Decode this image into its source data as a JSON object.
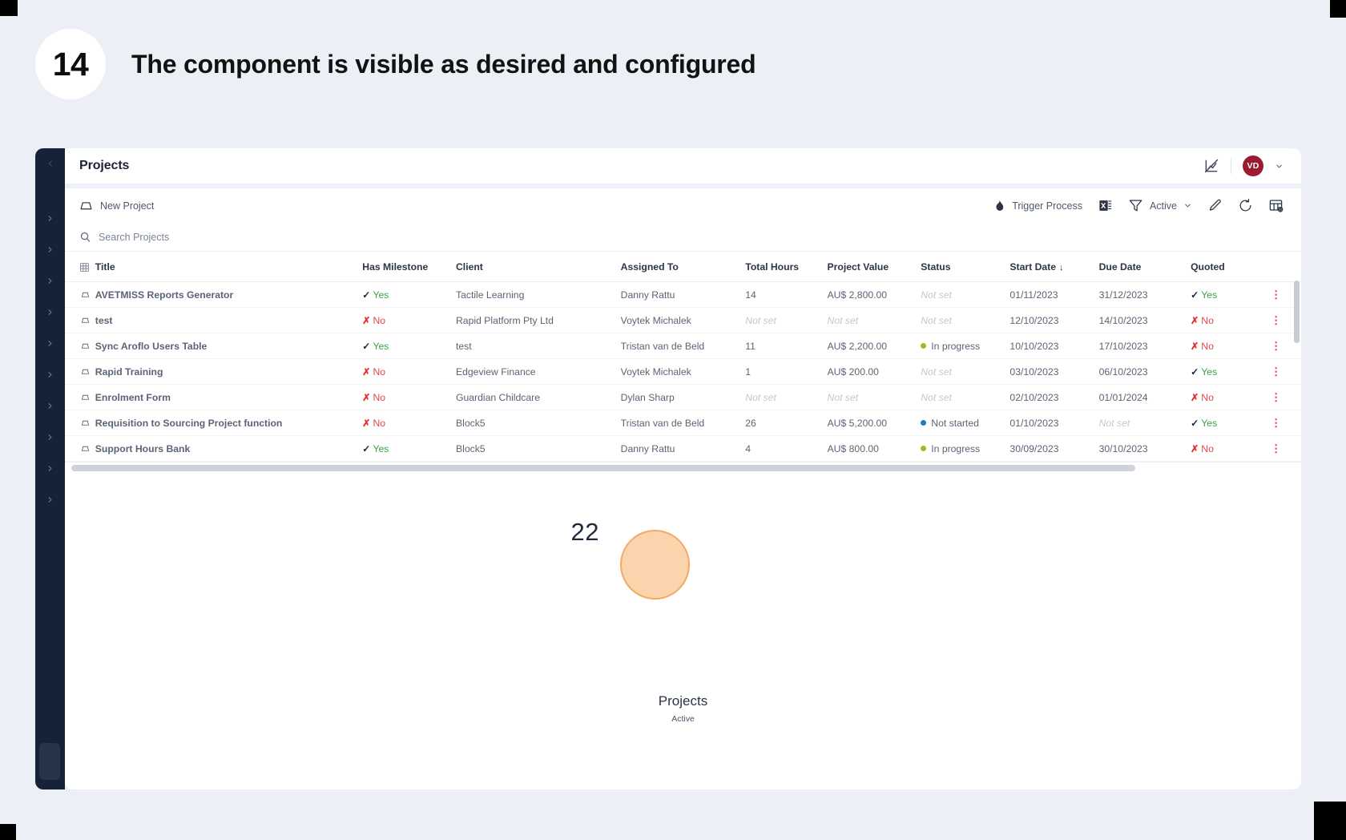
{
  "slide": {
    "step_number": "14",
    "title": "The component is visible as desired and configured"
  },
  "colors": {
    "page_background": "#eceff5",
    "sidebar": "#152238",
    "avatar": "#9b1b30",
    "bubble_fill": "#fbd3ac",
    "bubble_stroke": "#f5a961",
    "status_in_progress": "#8fc31f",
    "status_not_started": "#1f7fb5",
    "yes_green": "#3aa346",
    "no_red": "#e0474c"
  },
  "sidebar": {
    "collapse_icon": "chevron-left-icon",
    "items": [
      {
        "icon": "chevron-right-icon"
      },
      {
        "icon": "chevron-right-icon"
      },
      {
        "icon": "chevron-right-icon"
      },
      {
        "icon": "chevron-right-icon"
      },
      {
        "icon": "chevron-right-icon"
      },
      {
        "icon": "chevron-right-icon"
      },
      {
        "icon": "chevron-right-icon"
      },
      {
        "icon": "chevron-right-icon"
      },
      {
        "icon": "chevron-right-icon"
      },
      {
        "icon": "chevron-right-icon"
      }
    ]
  },
  "header": {
    "title": "Projects",
    "chart_toggle_icon": "chart-off-icon",
    "avatar_initials": "VD",
    "avatar_chevron_icon": "chevron-down-icon"
  },
  "toolbar": {
    "new_project_label": "New Project",
    "new_project_icon": "new-record-icon",
    "trigger_process_label": "Trigger Process",
    "trigger_process_icon": "flame-icon",
    "excel_export_icon": "excel-export-icon",
    "filter_icon": "filter-funnel-icon",
    "filter_label": "Active",
    "filter_chevron_icon": "chevron-down-icon",
    "edit_icon": "pencil-icon",
    "refresh_icon": "refresh-icon",
    "columns_icon": "table-settings-icon"
  },
  "search": {
    "placeholder": "Search Projects",
    "value": "",
    "icon": "search-icon"
  },
  "table": {
    "grid_icon": "grid-icon",
    "columns": [
      "Title",
      "Has Milestone",
      "Client",
      "Assigned To",
      "Total Hours",
      "Project Value",
      "Status",
      "Start Date",
      "Due Date",
      "Quoted"
    ],
    "sorted_column": "Start Date",
    "sort_direction_icon": "sort-descending-icon",
    "row_icon": "record-icon",
    "row_menu_icon": "vertical-dots-icon",
    "not_set_label": "Not set",
    "rows": [
      {
        "title": "AVETMISS Reports Generator",
        "has_milestone": "Yes",
        "client": "Tactile Learning",
        "assigned_to": "Danny Rattu",
        "total_hours": "14",
        "project_value": "AU$ 2,800.00",
        "status": "Not set",
        "start_date": "01/11/2023",
        "due_date": "31/12/2023",
        "quoted": "Yes"
      },
      {
        "title": "test",
        "has_milestone": "No",
        "client": "Rapid Platform Pty Ltd",
        "assigned_to": "Voytek Michalek",
        "total_hours": "Not set",
        "project_value": "Not set",
        "status": "Not set",
        "start_date": "12/10/2023",
        "due_date": "14/10/2023",
        "quoted": "No"
      },
      {
        "title": "Sync Aroflo Users Table",
        "has_milestone": "Yes",
        "client": "test",
        "assigned_to": "Tristan van de Beld",
        "total_hours": "11",
        "project_value": "AU$ 2,200.00",
        "status": "In progress",
        "start_date": "10/10/2023",
        "due_date": "17/10/2023",
        "quoted": "No"
      },
      {
        "title": "Rapid Training",
        "has_milestone": "No",
        "client": "Edgeview Finance",
        "assigned_to": "Voytek Michalek",
        "total_hours": "1",
        "project_value": "AU$ 200.00",
        "status": "Not set",
        "start_date": "03/10/2023",
        "due_date": "06/10/2023",
        "quoted": "Yes"
      },
      {
        "title": "Enrolment Form",
        "has_milestone": "No",
        "client": "Guardian Childcare",
        "assigned_to": "Dylan Sharp",
        "total_hours": "Not set",
        "project_value": "Not set",
        "status": "Not set",
        "start_date": "02/10/2023",
        "due_date": "01/01/2024",
        "quoted": "No"
      },
      {
        "title": "Requisition to Sourcing Project function",
        "has_milestone": "No",
        "client": "Block5",
        "assigned_to": "Tristan van de Beld",
        "total_hours": "26",
        "project_value": "AU$ 5,200.00",
        "status": "Not started",
        "start_date": "01/10/2023",
        "due_date": "Not set",
        "quoted": "Yes"
      },
      {
        "title": "Support Hours Bank",
        "has_milestone": "Yes",
        "client": "Block5",
        "assigned_to": "Danny Rattu",
        "total_hours": "4",
        "project_value": "AU$ 800.00",
        "status": "In progress",
        "start_date": "30/09/2023",
        "due_date": "30/10/2023",
        "quoted": "No"
      }
    ]
  },
  "chart_data": {
    "type": "scatter",
    "title": "Projects",
    "subtitle": "Active",
    "xlabel": "",
    "ylabel": "",
    "series": [
      {
        "name": "Active Projects",
        "points": [
          {
            "label": "22",
            "value": 22,
            "color": "#fbd3ac"
          }
        ]
      }
    ],
    "legend": "none",
    "grid": false
  }
}
